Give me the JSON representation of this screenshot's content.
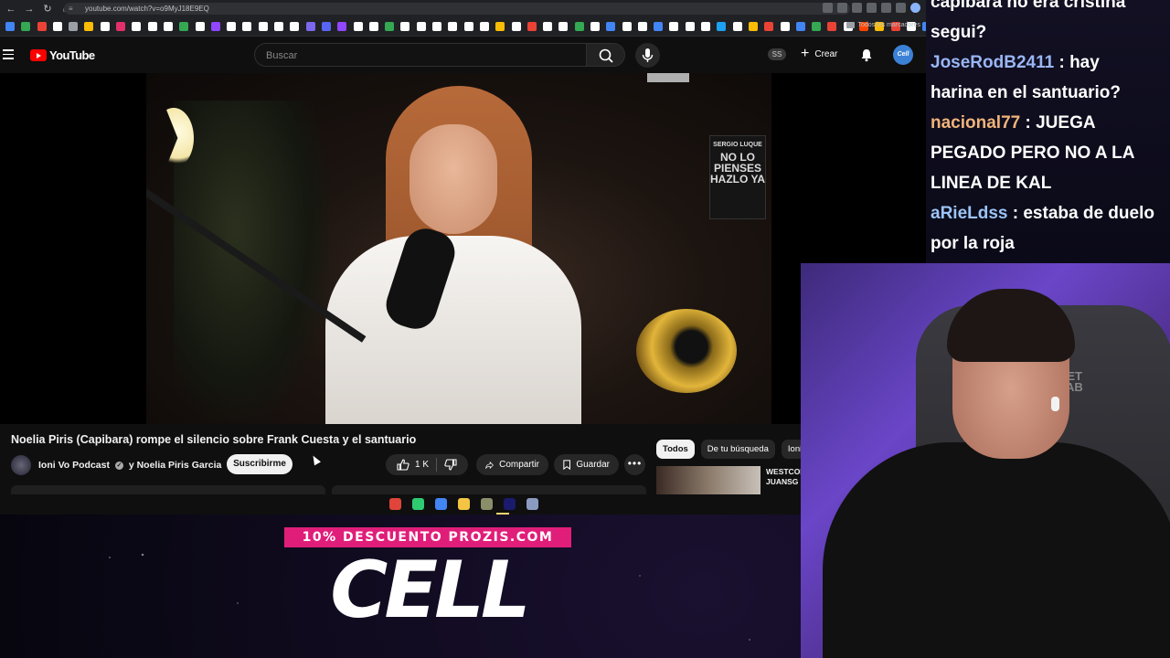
{
  "browser": {
    "url": "youtube.com/watch?v=o9MyJ18E9EQ",
    "bookmarks_all_label": "Todos los marcadores",
    "favicon_colors": [
      "#4285f4",
      "#34a853",
      "#ea4335",
      "#ffffff",
      "#9aa0a6",
      "#fbbc05",
      "#ffffff",
      "#e1306c",
      "#ffffff",
      "#ffffff",
      "#ffffff",
      "#34a853",
      "#ffffff",
      "#9146ff",
      "#ffffff",
      "#ffffff",
      "#ffffff",
      "#ffffff",
      "#ffffff",
      "#7b68ee",
      "#5865f2",
      "#9146ff",
      "#ffffff",
      "#ffffff",
      "#34a853",
      "#ffffff",
      "#ffffff",
      "#ffffff",
      "#ffffff",
      "#ffffff",
      "#ffffff",
      "#fbbc05",
      "#ffffff",
      "#ea4335",
      "#ffffff",
      "#ffffff",
      "#34a853",
      "#ffffff",
      "#4285f4",
      "#ffffff",
      "#ffffff",
      "#4285f4",
      "#ffffff",
      "#ffffff",
      "#ffffff",
      "#1da1f2",
      "#ffffff",
      "#fbbc05",
      "#ea4335",
      "#ffffff",
      "#4285f4",
      "#34a853",
      "#ea4335",
      "#ffffff",
      "#ff4500",
      "#fbbc05",
      "#ea4335",
      "#ffffff",
      "#4285f4",
      "#4285f4",
      "#fbbc05",
      "#4285f4",
      "#ea4335"
    ]
  },
  "youtube": {
    "logo_text": "YouTube",
    "search_placeholder": "Buscar",
    "ss_badge": "SS",
    "create_label": "Crear",
    "avatar_text": "Cell",
    "book_line1": "SERGIO LUQUE",
    "book_line2": "NO LO PIENSES HAZLO YA"
  },
  "video": {
    "title": "Noelia Piris (Capibara) rompe el silencio sobre Frank Cuesta y el santuario",
    "channel": "Ioni Vo Podcast",
    "channel_joiner": "y Noelia Piris Garcia",
    "subscribe_label": "Suscribirme",
    "likes": "1 K",
    "share_label": "Compartir",
    "save_label": "Guardar",
    "more_label": "•••"
  },
  "sidebar": {
    "chips": [
      "Todos",
      "De tu búsqueda",
      "Ioni"
    ],
    "rec_title": "WESTCOL\nJUANSG"
  },
  "taskbar": {
    "icon_colors": [
      "#e0443a",
      "#2ecc71",
      "#4285f4",
      "#f4c542",
      "#8a8f6a",
      "#1a1a6e",
      "#8a9bbf"
    ]
  },
  "chat": [
    {
      "user": "",
      "user_color": "",
      "message": "capibara no era cristina"
    },
    {
      "user": "",
      "user_color": "",
      "message": "segui?"
    },
    {
      "user": "JoseRodB2411",
      "user_color": "blue",
      "message": " : hay"
    },
    {
      "user": "",
      "user_color": "",
      "message": "harina en el santuario?"
    },
    {
      "user": "nacional77",
      "user_color": "orange",
      "message": " : JUEGA"
    },
    {
      "user": "",
      "user_color": "",
      "message": "PEGADO PERO NO A LA"
    },
    {
      "user": "",
      "user_color": "",
      "message": "LINEA DE KAL"
    },
    {
      "user": "aRieLdss",
      "user_color": "lblue",
      "message": " : estaba de duelo"
    },
    {
      "user": "",
      "user_color": "",
      "message": "por la roja"
    }
  ],
  "webcam": {
    "chair_logo": "RET\nLAB"
  },
  "promo": {
    "badge": "10% DESCUENTO PROZIS.COM",
    "brand": "CELL"
  }
}
